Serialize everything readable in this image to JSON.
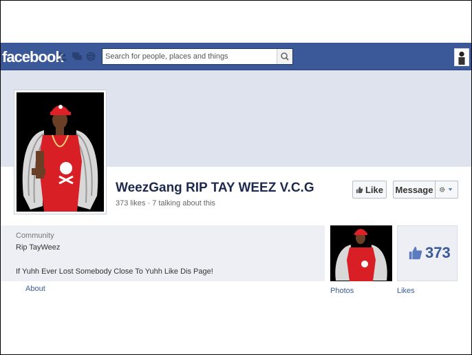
{
  "topbar": {
    "logo": "facebook",
    "search_placeholder": "Search for people, places and things",
    "icons": [
      "friend-requests-icon",
      "messages-icon",
      "notifications-icon",
      "search-icon"
    ]
  },
  "page": {
    "title": "WeezGang RIP TAY WEEZ V.C.G",
    "subtitle": "373 likes · 7 talking about this",
    "like_label": "Like",
    "message_label": "Message"
  },
  "about": {
    "category": "Community",
    "name": "Rip TayWeez",
    "description": "If Yuhh Ever Lost Somebody Close To Yuhh Like Dis Page!",
    "link": "About"
  },
  "tiles": {
    "photos_label": "Photos",
    "likes_label": "Likes",
    "likes_count": "373"
  },
  "colors": {
    "brand": "#3b5998",
    "cover": "#dfe3ee",
    "panel": "#edeff4"
  }
}
